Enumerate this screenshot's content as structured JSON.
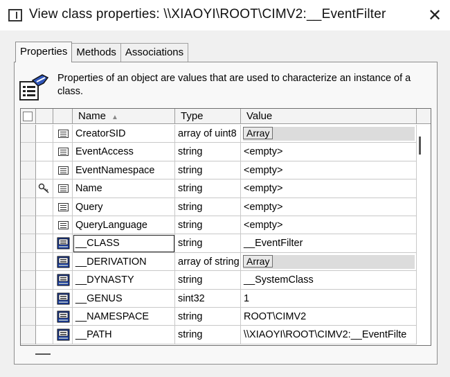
{
  "window": {
    "title": "View class properties: \\\\XIAOYI\\ROOT\\CIMV2:__EventFilter",
    "close_glyph": "✕"
  },
  "tabs": [
    {
      "label": "Properties",
      "active": true
    },
    {
      "label": "Methods",
      "active": false
    },
    {
      "label": "Associations",
      "active": false
    }
  ],
  "info_text": "Properties of an object are values that are used to characterize an instance of a class.",
  "grid": {
    "columns": {
      "name": "Name",
      "type": "Type",
      "value": "Value"
    },
    "rows": [
      {
        "name": "CreatorSID",
        "type": "array of uint8",
        "value": "Array",
        "value_is_button": true,
        "icon": "property-icon",
        "key": false
      },
      {
        "name": "EventAccess",
        "type": "string",
        "value": "<empty>",
        "icon": "property-icon",
        "key": false
      },
      {
        "name": "EventNamespace",
        "type": "string",
        "value": "<empty>",
        "icon": "property-icon",
        "key": false
      },
      {
        "name": "Name",
        "type": "string",
        "value": "<empty>",
        "icon": "property-icon",
        "key": true
      },
      {
        "name": "Query",
        "type": "string",
        "value": "<empty>",
        "icon": "property-icon",
        "key": false
      },
      {
        "name": "QueryLanguage",
        "type": "string",
        "value": "<empty>",
        "icon": "property-icon",
        "key": false
      },
      {
        "name": "__CLASS",
        "type": "string",
        "value": "__EventFilter",
        "icon": "system-property-icon",
        "key": false,
        "focused": true
      },
      {
        "name": "__DERIVATION",
        "type": "array of string",
        "value": "Array",
        "value_is_button": true,
        "icon": "system-property-icon",
        "key": false
      },
      {
        "name": "__DYNASTY",
        "type": "string",
        "value": "__SystemClass",
        "icon": "system-property-icon",
        "key": false
      },
      {
        "name": "__GENUS",
        "type": "sint32",
        "value": "1",
        "icon": "system-property-icon",
        "key": false
      },
      {
        "name": "__NAMESPACE",
        "type": "string",
        "value": "ROOT\\CIMV2",
        "icon": "system-property-icon",
        "key": false
      },
      {
        "name": "__PATH",
        "type": "string",
        "value": "\\\\XIAOYI\\ROOT\\CIMV2:__EventFilte",
        "icon": "system-property-icon",
        "key": false
      }
    ]
  }
}
